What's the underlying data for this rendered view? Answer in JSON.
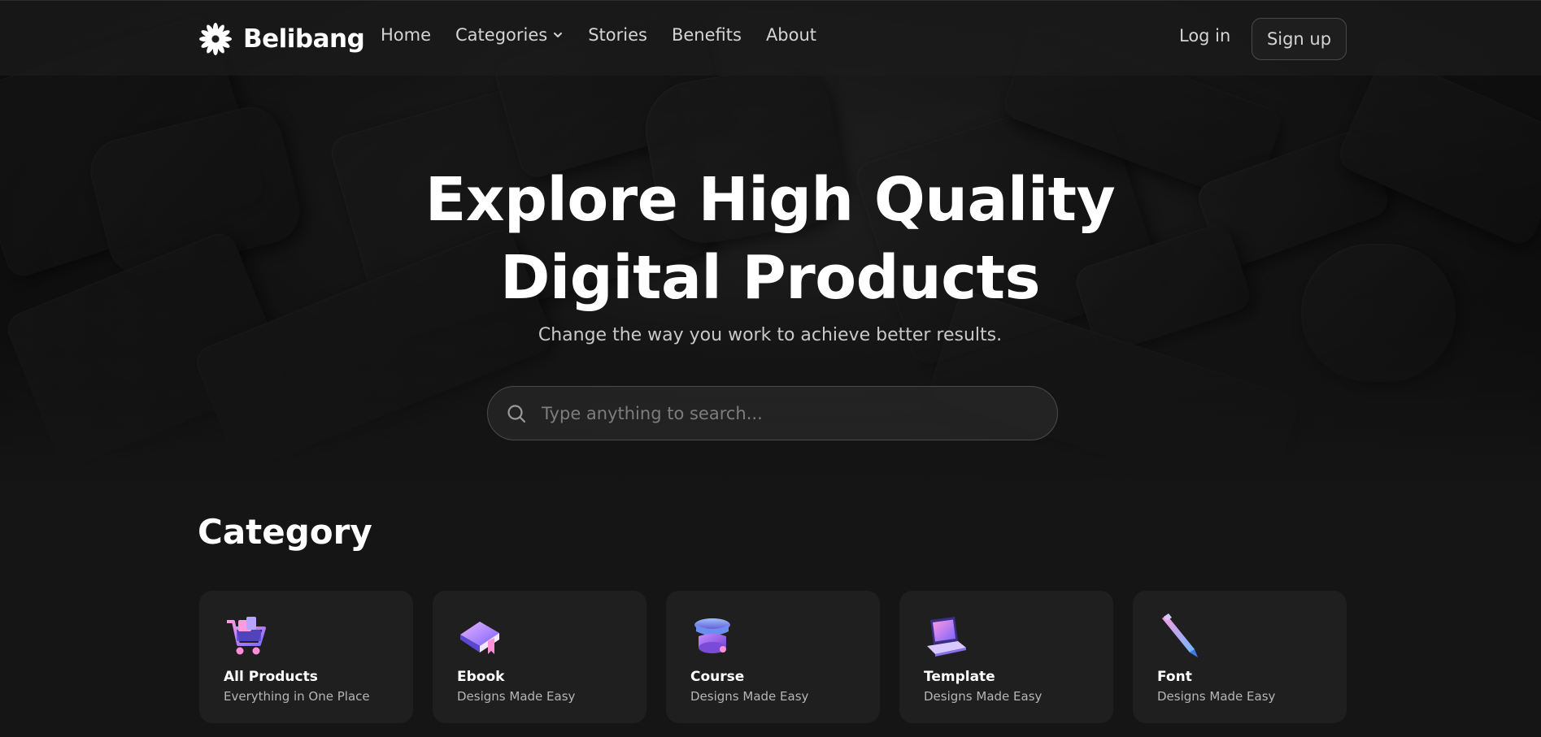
{
  "brand": {
    "name": "Belibang"
  },
  "nav": {
    "items": [
      {
        "label": "Home"
      },
      {
        "label": "Categories",
        "has_dropdown": true
      },
      {
        "label": "Stories"
      },
      {
        "label": "Benefits"
      },
      {
        "label": "About"
      }
    ],
    "login_label": "Log in",
    "signup_label": "Sign up"
  },
  "hero": {
    "title_line1": "Explore High Quality",
    "title_line2": "Digital Products",
    "subtitle": "Change the way you work to achieve better results.",
    "search": {
      "placeholder": "Type anything to search...",
      "icon": "search-icon"
    }
  },
  "category": {
    "title": "Category",
    "cards": [
      {
        "name": "All Products",
        "desc": "Everything in One Place",
        "icon": "shopping-cart-icon"
      },
      {
        "name": "Ebook",
        "desc": "Designs Made Easy",
        "icon": "book-icon"
      },
      {
        "name": "Course",
        "desc": "Designs Made Easy",
        "icon": "graduation-cap-icon"
      },
      {
        "name": "Template",
        "desc": "Designs Made Easy",
        "icon": "laptop-icon"
      },
      {
        "name": "Font",
        "desc": "Designs Made Easy",
        "icon": "pen-icon"
      }
    ]
  },
  "colors": {
    "background": "#151515",
    "card": "#1f1f1f",
    "text_muted": "#b5b5b5",
    "accent_purple": "#9b7bff",
    "accent_pink": "#ff8fd6"
  }
}
